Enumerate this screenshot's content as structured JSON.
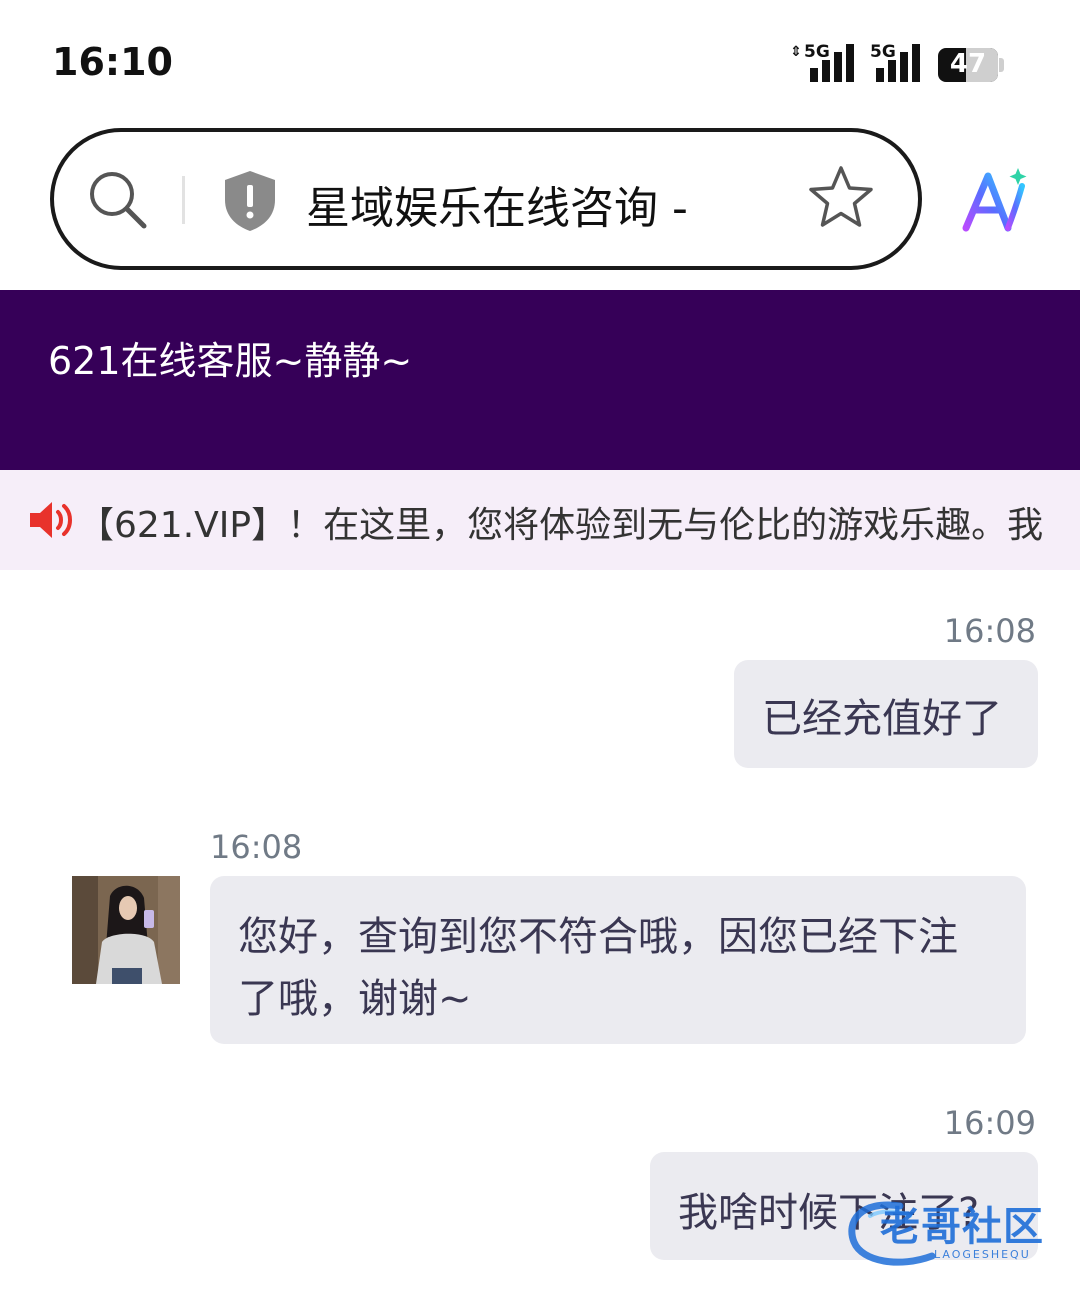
{
  "status_bar": {
    "time": "16:10",
    "signal_1": "5G",
    "signal_2": "5G",
    "battery": "47",
    "battery_level": 0.47
  },
  "browser": {
    "page_title": "星域娱乐在线咨询 -",
    "icons": [
      "search-icon",
      "shield-icon",
      "star-icon",
      "ai-assistant-icon"
    ]
  },
  "chat": {
    "header_title": "621在线客服~静静~",
    "notice": "【621.VIP】！在这里，您将体验到无与伦比的游戏乐趣。我",
    "messages": [
      {
        "side": "right",
        "time": "16:08",
        "text": "已经充值好了"
      },
      {
        "side": "left",
        "time": "16:08",
        "line1": "您好，查询到您不符合哦，因您已经下注",
        "line2": "了哦，谢谢~"
      },
      {
        "side": "right",
        "time": "16:09",
        "text": "我啥时候下注了?"
      }
    ]
  },
  "watermark": {
    "text": "老哥社区",
    "subtext": "LAOGESHEQU"
  },
  "colors": {
    "header_bg": "#360058",
    "notice_bg": "#f6eef9",
    "bubble_bg": "#ebebf0",
    "time_text": "#707a86",
    "speaker_red": "#e8322c"
  }
}
